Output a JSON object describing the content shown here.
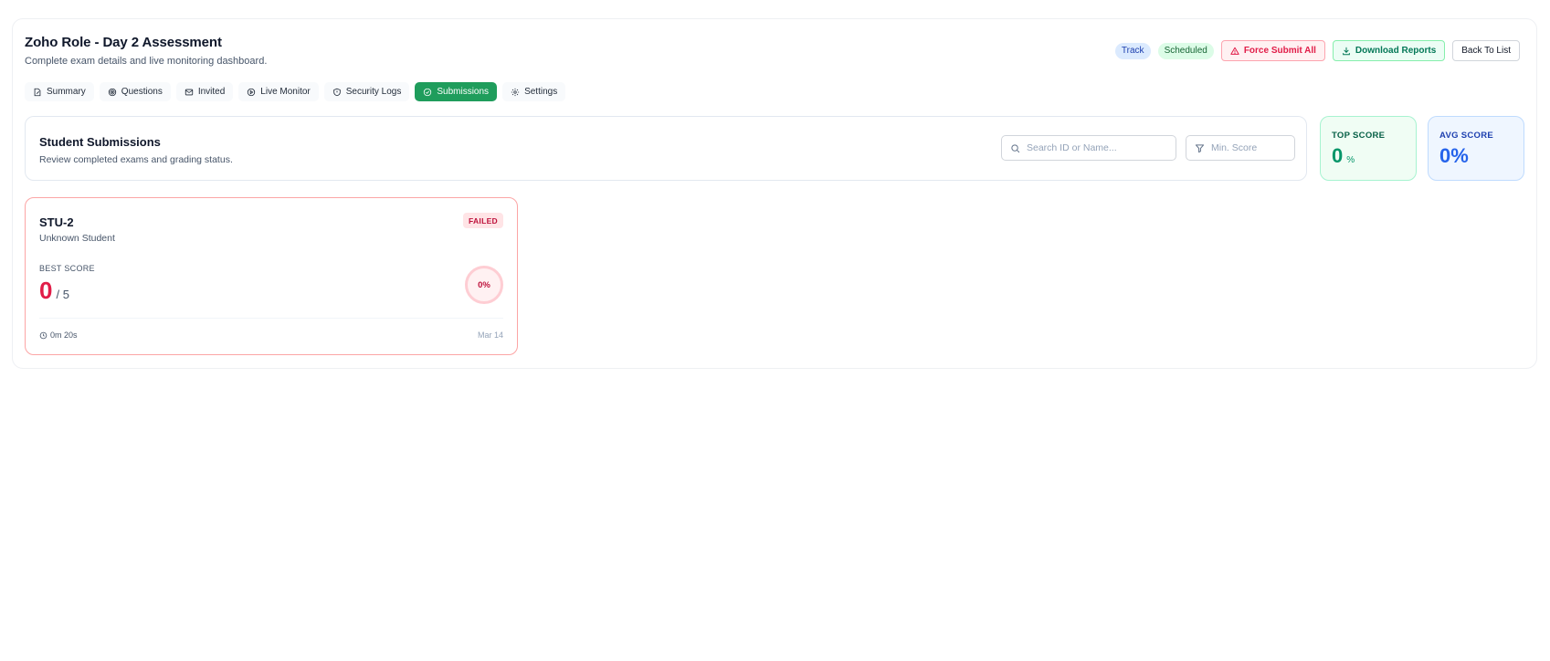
{
  "header": {
    "title": "Zoho Role - Day 2 Assessment",
    "subtitle": "Complete exam details and live monitoring dashboard."
  },
  "badges": {
    "track": "Track",
    "scheduled": "Scheduled"
  },
  "actions": {
    "force_submit": "Force Submit All",
    "download_reports": "Download Reports",
    "back": "Back To List"
  },
  "tabs": [
    {
      "label": "Summary",
      "icon": "edit-icon"
    },
    {
      "label": "Questions",
      "icon": "target-icon"
    },
    {
      "label": "Invited",
      "icon": "mail-icon"
    },
    {
      "label": "Live Monitor",
      "icon": "play-circle-icon"
    },
    {
      "label": "Security Logs",
      "icon": "shield-icon"
    },
    {
      "label": "Submissions",
      "icon": "check-circle-icon",
      "active": true
    },
    {
      "label": "Settings",
      "icon": "gear-icon"
    }
  ],
  "submissions": {
    "title": "Student Submissions",
    "description": "Review completed exams and grading status.",
    "search_placeholder": "Search ID or Name...",
    "min_score_placeholder": "Min. Score"
  },
  "stats": {
    "top_score_label": "TOP SCORE",
    "top_score_value": "0",
    "top_score_unit": "%",
    "avg_score_label": "AVG SCORE",
    "avg_score_value": "0%"
  },
  "cards": [
    {
      "id": "STU-2",
      "name": "Unknown Student",
      "status": "FAILED",
      "best_score_label": "BEST SCORE",
      "score": "0",
      "total": "/ 5",
      "percent": "0%",
      "duration": "0m 20s",
      "date": "Mar 14"
    }
  ],
  "colors": {
    "accent_green": "#1f9d5c",
    "danger": "#e11d48",
    "info": "#2563eb"
  }
}
